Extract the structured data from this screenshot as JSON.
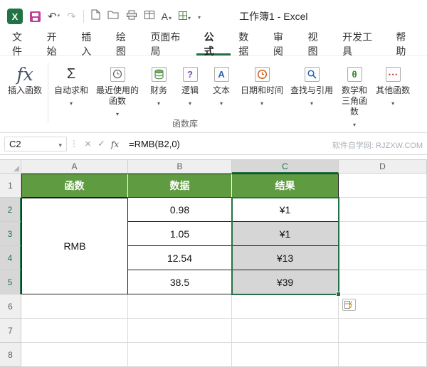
{
  "titlebar": {
    "title": "工作簿1 - Excel"
  },
  "tabs": [
    {
      "label": "文件"
    },
    {
      "label": "开始"
    },
    {
      "label": "插入"
    },
    {
      "label": "绘图"
    },
    {
      "label": "页面布局"
    },
    {
      "label": "公式"
    },
    {
      "label": "数据"
    },
    {
      "label": "审阅"
    },
    {
      "label": "视图"
    },
    {
      "label": "开发工具"
    },
    {
      "label": "帮助"
    }
  ],
  "ribbon": {
    "group_label": "函数库",
    "buttons": [
      {
        "label": "插入函数"
      },
      {
        "label": "自动求和"
      },
      {
        "label": "最近使用的函数"
      },
      {
        "label": "财务"
      },
      {
        "label": "逻辑"
      },
      {
        "label": "文本"
      },
      {
        "label": "日期和时间"
      },
      {
        "label": "查找与引用"
      },
      {
        "label": "数学和三角函数"
      },
      {
        "label": "其他函数"
      }
    ]
  },
  "formula_bar": {
    "name_box": "C2",
    "formula": "=RMB(B2,0)",
    "watermark": "软件自学网: RJZXW.COM"
  },
  "grid": {
    "column_headers": [
      "A",
      "B",
      "C",
      "D"
    ],
    "row_headers": [
      "1",
      "2",
      "3",
      "4",
      "5",
      "6",
      "7",
      "8"
    ],
    "header_row": {
      "a": "函数",
      "b": "数据",
      "c": "结果"
    },
    "merged_function_name": "RMB",
    "rows": [
      {
        "b": "0.98",
        "c": "¥1"
      },
      {
        "b": "1.05",
        "c": "¥1"
      },
      {
        "b": "12.54",
        "c": "¥13"
      },
      {
        "b": "38.5",
        "c": "¥39"
      }
    ],
    "active_cell": "C2",
    "selection_range": "C2:C5"
  },
  "colors": {
    "excel_green": "#217346",
    "header_green": "#5E9B41",
    "selection_fill": "#D6D6D6",
    "save_magenta": "#BF3F9A"
  }
}
